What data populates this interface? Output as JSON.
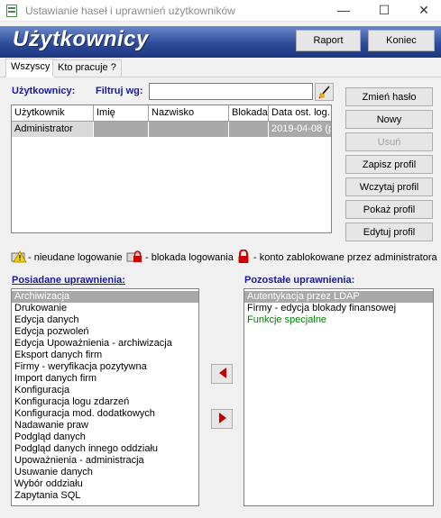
{
  "window": {
    "title": "Ustawianie haseł i uprawnień użytkowników",
    "minimize": "—",
    "maximize": "☐",
    "close": "✕"
  },
  "header": {
    "title": "Użytkownicy",
    "report_button": "Raport",
    "end_button": "Koniec"
  },
  "tabs": [
    {
      "label": "Wszyscy",
      "active": true
    },
    {
      "label": "Kto pracuje ?",
      "active": false
    }
  ],
  "users": {
    "label": "Użytkownicy:",
    "filter_label": "Filtruj wg:",
    "filter_value": "",
    "columns": [
      "Użytkownik",
      "Imię",
      "Nazwisko",
      "Blokada",
      "Data ost. log."
    ],
    "rows": [
      {
        "user": "Administrator",
        "first": "",
        "last": "",
        "block": "",
        "date": "2019-04-08 (p"
      }
    ]
  },
  "actions": {
    "change_password": "Zmień hasło",
    "new": "Nowy",
    "delete": "Usuń",
    "save_profile": "Zapisz profil",
    "load_profile": "Wczytaj profil",
    "show_profile": "Pokaż profil",
    "edit_profile": "Edytuj profil"
  },
  "legend": {
    "failed_login": "- nieudane logowanie",
    "login_lock": "- blokada logowania",
    "account_locked": "- konto zablokowane przez administratora"
  },
  "permissions": {
    "owned_label": "Posiadane uprawnienia:",
    "other_label": "Pozostałe uprawnienia:",
    "owned": [
      "Archiwizacja",
      "Drukowanie",
      "Edycja danych",
      "Edycja pozwoleń",
      "Edycja Upoważnienia - archiwizacja",
      "Eksport danych firm",
      "Firmy - weryfikacja pozytywna",
      "Import danych firm",
      "Konfiguracja",
      "Konfiguracja logu zdarzeń",
      "Konfiguracja mod. dodatkowych",
      "Nadawanie praw",
      "Podgląd danych",
      "Podgląd danych innego oddziału",
      "Upoważnienia - administracja",
      "Usuwanie danych",
      "Wybór oddziału",
      "Zapytania SQL"
    ],
    "other": [
      "Autentykacja przez LDAP",
      "Firmy - edycja blokady finansowej",
      "Funkcje specjalne"
    ]
  },
  "colors": {
    "banner": "#2f4c9a",
    "label_blue": "#1a1a9a",
    "selection": "#a9a9a9",
    "green_item": "#008000",
    "arrow_red": "#c00000"
  }
}
